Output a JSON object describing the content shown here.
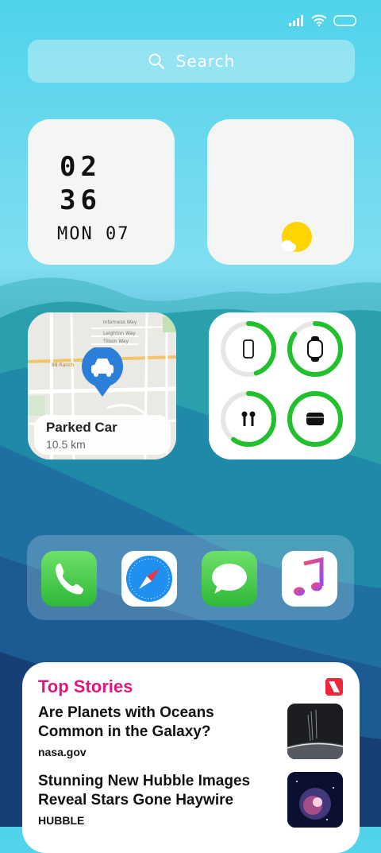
{
  "status": {
    "icons": [
      "signal-icon",
      "wifi-icon",
      "battery-icon"
    ]
  },
  "search": {
    "placeholder": "Search"
  },
  "clock_widget": {
    "hour": "02",
    "minute": "36",
    "date": "MON 07"
  },
  "weather_widget": {
    "icon": "sun-cloud-icon"
  },
  "map_widget": {
    "title": "Parked Car",
    "distance": "10.5 km",
    "pin_color": "#2b7fd9",
    "street_labels": [
      "Interness Way",
      "Leighton Way",
      "Tilson Way",
      "Ridgeview Way",
      "Longhorn Rd"
    ]
  },
  "battery_widget": {
    "ring_color": "#20c12c",
    "devices": [
      {
        "name": "phone-icon",
        "level": 0.45
      },
      {
        "name": "watch-icon",
        "level": 0.85
      },
      {
        "name": "airpods-icon",
        "level": 0.6
      },
      {
        "name": "case-icon",
        "level": 1.0
      }
    ]
  },
  "dock": {
    "apps": [
      "Phone",
      "Safari",
      "Messages",
      "Music"
    ]
  },
  "news_widget": {
    "heading": "Top Stories",
    "accent": "#e0177c",
    "stories": [
      {
        "title_line1": "Are Planets with Oceans",
        "title_line2": "Common in the Galaxy?",
        "source": "nasa.gov"
      },
      {
        "title_line1": "Stunning New Hubble Images",
        "title_line2": "Reveal Stars Gone Haywire",
        "source": "HUBBLE"
      }
    ]
  }
}
